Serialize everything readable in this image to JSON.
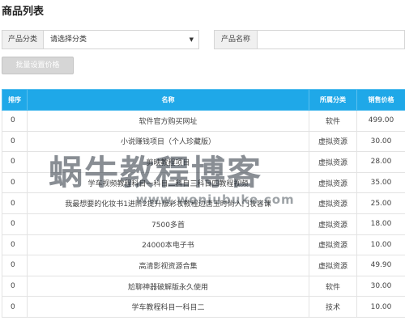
{
  "page": {
    "title": "商品列表"
  },
  "filters": {
    "category_label": "产品分类",
    "category_selected": "请选择分类",
    "name_label": "产品名称",
    "name_value": "",
    "name_placeholder": ""
  },
  "toolbar": {
    "batch_price_label": "批量设置价格"
  },
  "table": {
    "headers": {
      "sort": "排序",
      "name": "名称",
      "category": "所属分类",
      "price": "销售价格"
    },
    "rows": [
      {
        "sort": "0",
        "name": "软件官方购买网址",
        "category": "软件",
        "price": "499.00"
      },
      {
        "sort": "0",
        "name": "小说赚钱项目（个人珍藏版）",
        "category": "虚拟资源",
        "price": "30.00"
      },
      {
        "sort": "0",
        "name": "剪映教程项目",
        "category": "虚拟资源",
        "price": "28.00"
      },
      {
        "sort": "0",
        "name": "学车视频教程科目一科目二科目三科目四教程视频",
        "category": "虚拟资源",
        "price": "35.00"
      },
      {
        "sort": "0",
        "name": "我最想要的化妆书1进阶2提升版彩妆教程边唐玉时尚入门妆容课",
        "category": "虚拟资源",
        "price": "25.00"
      },
      {
        "sort": "0",
        "name": "7500多首",
        "category": "虚拟资源",
        "price": "18.00"
      },
      {
        "sort": "0",
        "name": "24000本电子书",
        "category": "虚拟资源",
        "price": "10.00"
      },
      {
        "sort": "0",
        "name": "高清影视资源合集",
        "category": "虚拟资源",
        "price": "49.90"
      },
      {
        "sort": "0",
        "name": "尬聊神器破解版永久使用",
        "category": "软件",
        "price": "30.00"
      },
      {
        "sort": "0",
        "name": "学车教程科目一科目二",
        "category": "技术",
        "price": "10.00"
      }
    ]
  },
  "watermark": {
    "main": "蜗牛教程博客",
    "sub": "www.woniubuke.com"
  },
  "colors": {
    "header_bg": "#1fa8e8",
    "button_bg": "#d6d6d6"
  },
  "icons": {
    "select_caret": "caret-down-icon"
  }
}
